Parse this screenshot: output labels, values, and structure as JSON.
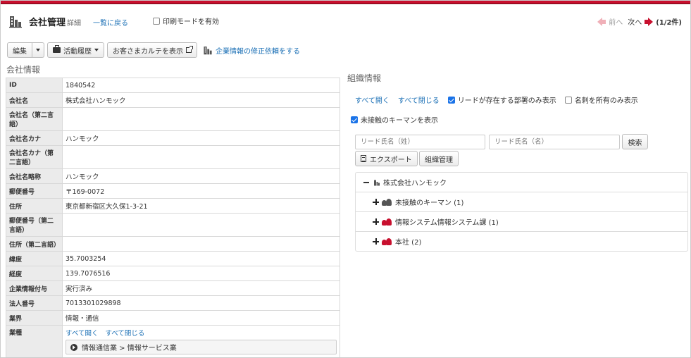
{
  "header": {
    "title": "会社管理",
    "subtitle": "詳細",
    "back_link": "一覧に戻る",
    "print_mode_label": "印刷モードを有効",
    "prev_label": "前へ",
    "next_label": "次へ",
    "page_count": "(1/2件)"
  },
  "toolbar": {
    "edit_label": "編集",
    "activity_label": "活動履歴",
    "karte_label": "お客さまカルテを表示",
    "fix_request_label": "企業情報の修正依頼をする"
  },
  "company_section": {
    "title": "会社情報",
    "rows": [
      {
        "label": "ID",
        "value": "1840542"
      },
      {
        "label": "会社名",
        "value": "株式会社ハンモック"
      },
      {
        "label": "会社名（第二言語）",
        "value": ""
      },
      {
        "label": "会社名カナ",
        "value": "ハンモック"
      },
      {
        "label": "会社名カナ（第二言語）",
        "value": ""
      },
      {
        "label": "会社名略称",
        "value": "ハンモック"
      },
      {
        "label": "郵便番号",
        "value": "〒169-0072"
      },
      {
        "label": "住所",
        "value": "東京都新宿区大久保1-3-21"
      },
      {
        "label": "郵便番号（第二言語）",
        "value": ""
      },
      {
        "label": "住所（第二言語）",
        "value": ""
      },
      {
        "label": "緯度",
        "value": "35.7003254"
      },
      {
        "label": "経度",
        "value": "139.7076516"
      },
      {
        "label": "企業情報付与",
        "value": "実行済み"
      },
      {
        "label": "法人番号",
        "value": "7013301029898"
      },
      {
        "label": "業界",
        "value": "情報・通信"
      }
    ],
    "industry_row": {
      "label": "業種",
      "expand_all": "すべて開く",
      "collapse_all": "すべて閉じる",
      "path": "情報通信業 > 情報サービス業"
    }
  },
  "org_section": {
    "title": "組織情報",
    "expand_all": "すべて開く",
    "collapse_all": "すべて閉じる",
    "lead_only_label": "リードが存在する部署のみ表示",
    "lead_only_checked": true,
    "card_only_label": "名刺を所有のみ表示",
    "card_only_checked": false,
    "unvisited_label": "未接触のキーマンを表示",
    "unvisited_checked": true,
    "last_name_placeholder": "リード氏名（姓）",
    "first_name_placeholder": "リード氏名（名）",
    "search_label": "検索",
    "export_label": "エクスポート",
    "org_manage_label": "組織管理",
    "tree": {
      "root": "株式会社ハンモック",
      "children": [
        {
          "label": "未接触のキーマン (1)",
          "icon": "people-gray-icon"
        },
        {
          "label": "情報システム情報システム課 (1)",
          "icon": "people-red-icon"
        },
        {
          "label": "本社 (2)",
          "icon": "people-red-icon"
        }
      ]
    }
  },
  "colors": {
    "brand_red": "#c8102e",
    "link_blue": "#1a6fb5",
    "label_bg": "#ebebeb"
  }
}
